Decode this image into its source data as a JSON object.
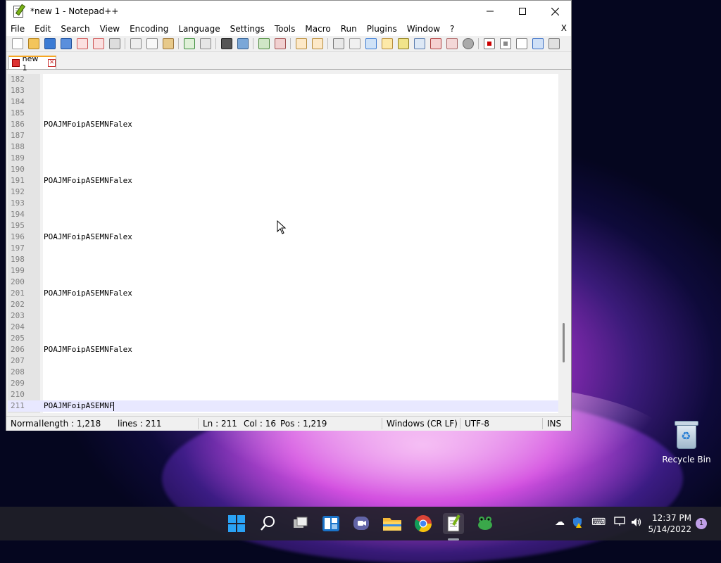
{
  "window": {
    "title": "*new 1 - Notepad++",
    "minimize_icon": "minimize-icon",
    "maximize_icon": "maximize-icon",
    "close_icon": "close-icon"
  },
  "menu": {
    "items": [
      "File",
      "Edit",
      "Search",
      "View",
      "Encoding",
      "Language",
      "Settings",
      "Tools",
      "Macro",
      "Run",
      "Plugins",
      "Window",
      "?"
    ],
    "close_label": "X"
  },
  "tab": {
    "label": "new 1"
  },
  "editor": {
    "lines": [
      {
        "n": "182",
        "text": ""
      },
      {
        "n": "183",
        "text": ""
      },
      {
        "n": "184",
        "text": ""
      },
      {
        "n": "185",
        "text": ""
      },
      {
        "n": "186",
        "text": "POAJMFoipASEMNFalex"
      },
      {
        "n": "187",
        "text": ""
      },
      {
        "n": "188",
        "text": ""
      },
      {
        "n": "189",
        "text": ""
      },
      {
        "n": "190",
        "text": ""
      },
      {
        "n": "191",
        "text": "POAJMFoipASEMNFalex"
      },
      {
        "n": "192",
        "text": ""
      },
      {
        "n": "193",
        "text": ""
      },
      {
        "n": "194",
        "text": ""
      },
      {
        "n": "195",
        "text": ""
      },
      {
        "n": "196",
        "text": "POAJMFoipASEMNFalex"
      },
      {
        "n": "197",
        "text": ""
      },
      {
        "n": "198",
        "text": ""
      },
      {
        "n": "199",
        "text": ""
      },
      {
        "n": "200",
        "text": ""
      },
      {
        "n": "201",
        "text": "POAJMFoipASEMNFalex"
      },
      {
        "n": "202",
        "text": ""
      },
      {
        "n": "203",
        "text": ""
      },
      {
        "n": "204",
        "text": ""
      },
      {
        "n": "205",
        "text": ""
      },
      {
        "n": "206",
        "text": "POAJMFoipASEMNFalex"
      },
      {
        "n": "207",
        "text": ""
      },
      {
        "n": "208",
        "text": ""
      },
      {
        "n": "209",
        "text": ""
      },
      {
        "n": "210",
        "text": ""
      },
      {
        "n": "211",
        "text": "POAJMFoipASEMNF",
        "current": true
      }
    ]
  },
  "status": {
    "mode": "Normal",
    "length": "length : 1,218",
    "lines": "lines : 211",
    "ln": "Ln : 211",
    "col": "Col : 16",
    "pos": "Pos : 1,219",
    "eol": "Windows (CR LF)",
    "encoding": "UTF-8",
    "ins": "INS"
  },
  "desktop": {
    "recycle_bin": "Recycle Bin"
  },
  "taskbar": {
    "time": "12:37 PM",
    "date": "5/14/2022",
    "notifications": "1"
  },
  "colors": {
    "current_line": "#e8e8ff",
    "gutter": "#e4e4e4",
    "tab_accent": "#f5a623",
    "windows_blue": "#2aa2f5"
  }
}
